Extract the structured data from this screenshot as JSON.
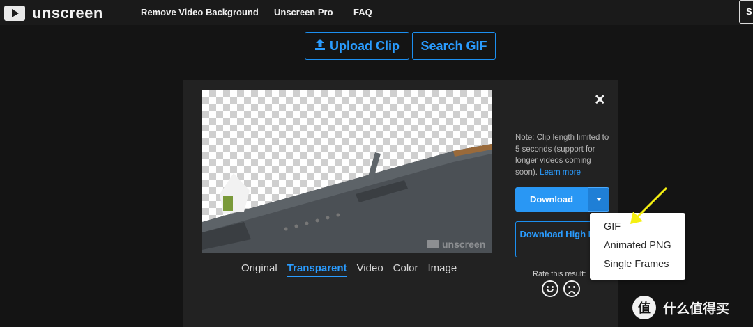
{
  "brand": {
    "name": "unscreen",
    "icon": "play-icon"
  },
  "nav": {
    "items": [
      "Remove Video Background",
      "Unscreen Pro",
      "FAQ"
    ],
    "signin": "S"
  },
  "actions": {
    "upload_label": "Upload Clip",
    "upload_icon": "upload-icon",
    "search_label": "Search GIF"
  },
  "preview": {
    "watermark": "unscreen"
  },
  "tabs": {
    "items": [
      "Original",
      "Transparent",
      "Video",
      "Color",
      "Image"
    ],
    "active": "Transparent"
  },
  "side": {
    "close_icon": "close-icon",
    "note": "Note: Clip length limited to 5 seconds (support for longer videos coming soon).",
    "learn_more": "Learn more",
    "download_label": "Download",
    "download_hires_label": "Download High Res",
    "rate_label": "Rate this result:"
  },
  "dropdown": {
    "options": [
      "GIF",
      "Animated PNG",
      "Single Frames"
    ]
  },
  "footer_watermark": {
    "icon_text": "值",
    "text": "什么值得买"
  },
  "colors": {
    "accent": "#2997f4",
    "background": "#141414",
    "panel": "#222222",
    "annotation": "#f5f012"
  }
}
